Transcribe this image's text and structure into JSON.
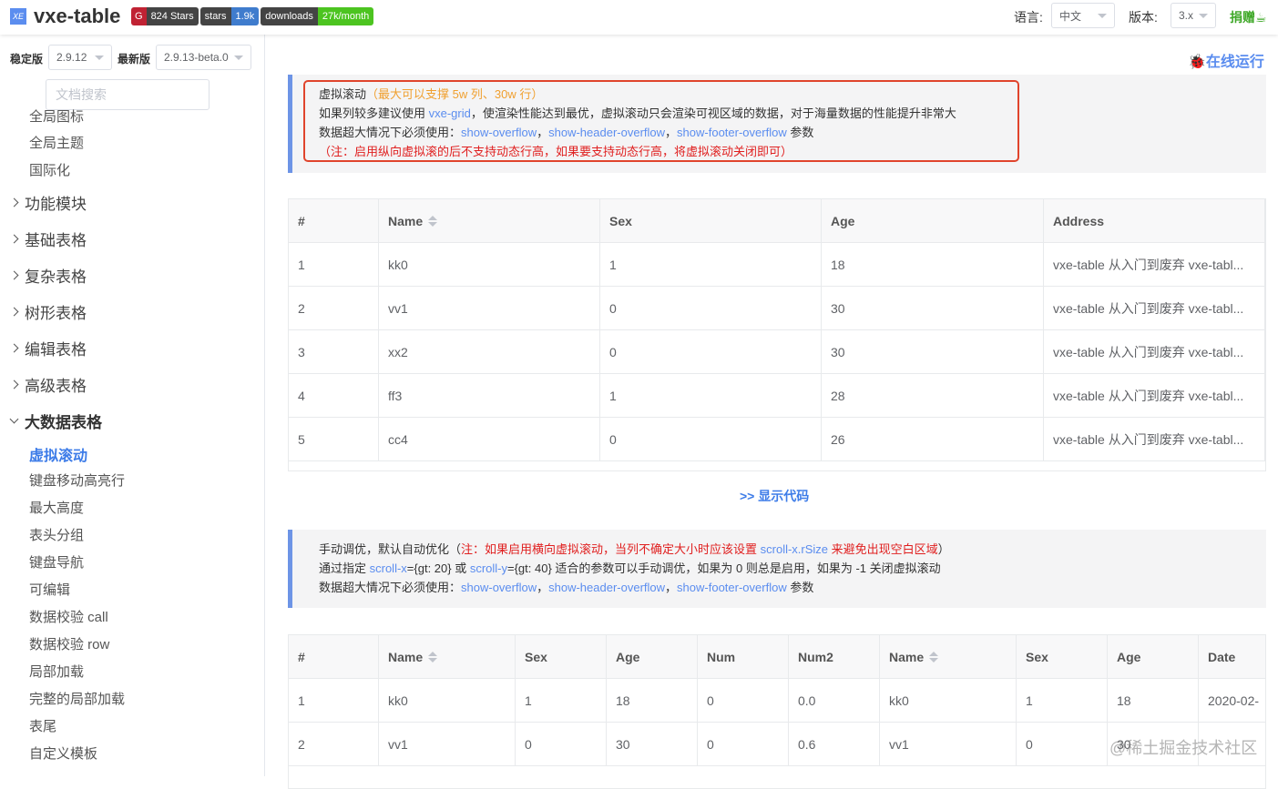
{
  "header": {
    "logo_text": "XE",
    "brand": "vxe-table",
    "badges": [
      {
        "left": "824 Stars"
      },
      {
        "left": "stars",
        "right": "1.9k"
      },
      {
        "left": "downloads",
        "right": "27k/month"
      }
    ],
    "lang_label": "语言:",
    "lang_value": "中文",
    "version_label": "版本:",
    "version_value": "3.x",
    "donate": "捐赠"
  },
  "sidebar": {
    "stable_label": "稳定版",
    "stable_value": "2.9.12",
    "latest_label": "最新版",
    "latest_value": "2.9.13-beta.0",
    "search_placeholder": "文档搜索",
    "top_items": [
      "全局图标",
      "全局主题",
      "国际化"
    ],
    "groups": [
      "功能模块",
      "基础表格",
      "复杂表格",
      "树形表格",
      "编辑表格",
      "高级表格",
      "大数据表格"
    ],
    "sub_items": [
      "虚拟滚动",
      "键盘移动高亮行",
      "最大高度",
      "表头分组",
      "键盘导航",
      "可编辑",
      "数据校验 call",
      "数据校验 row",
      "局部加载",
      "完整的局部加载",
      "表尾",
      "自定义模板"
    ],
    "active": "虚拟滚动"
  },
  "main": {
    "run_online": "在线运行",
    "tip1": {
      "title": "虚拟滚动",
      "title_note": "（最大可以支撑 5w 列、30w 行）",
      "l2a": "如果列较多建议使用 ",
      "l2link": "vxe-grid",
      "l2b": "，使渲染性能达到最优，虚拟滚动只会渲染可视区域的数据，对于海量数据的性能提升非常大",
      "l3a": "数据超大情况下必须使用：",
      "o1": "show-overflow",
      "sep": "，",
      "o2": "show-header-overflow",
      "o3": "show-footer-overflow",
      "l3b": " 参数",
      "l4": "（注：启用纵向虚拟滚的后不支持动态行高，如果要支持动态行高，将虚拟滚动关闭即可）"
    },
    "table1": {
      "headers": [
        "#",
        "Name",
        "Sex",
        "Age",
        "Address"
      ],
      "rows": [
        [
          "1",
          "kk0",
          "1",
          "18",
          "vxe-table 从入门到废弃 vxe-tabl..."
        ],
        [
          "2",
          "vv1",
          "0",
          "30",
          "vxe-table 从入门到废弃 vxe-tabl..."
        ],
        [
          "3",
          "xx2",
          "0",
          "30",
          "vxe-table 从入门到废弃 vxe-tabl..."
        ],
        [
          "4",
          "ff3",
          "1",
          "28",
          "vxe-table 从入门到废弃 vxe-tabl..."
        ],
        [
          "5",
          "cc4",
          "0",
          "26",
          "vxe-table 从入门到废弃 vxe-tabl..."
        ]
      ]
    },
    "show_code": ">> 显示代码",
    "tip2": {
      "l1a": "手动调优，默认自动优化（",
      "l1red": "注：如果启用横向虚拟滚动，当列不确定大小时应该设置 ",
      "l1link": "scroll-x.rSize",
      "l1red2": " 来避免出现空白区域",
      "l1b": "）",
      "l2a": "通过指定 ",
      "sx": "scroll-x",
      "l2b": "={gt: 20} 或 ",
      "sy": "scroll-y",
      "l2c": "={gt: 40} 适合的参数可以手动调优，如果为 0 则总是启用，如果为 -1 关闭虚拟滚动",
      "l3a": "数据超大情况下必须使用：",
      "o1": "show-overflow",
      "sep": "，",
      "o2": "show-header-overflow",
      "o3": "show-footer-overflow",
      "l3b": " 参数"
    },
    "table2": {
      "headers": [
        "#",
        "Name",
        "Sex",
        "Age",
        "Num",
        "Num2",
        "Name",
        "Sex",
        "Age",
        "Date"
      ],
      "rows": [
        [
          "1",
          "kk0",
          "1",
          "18",
          "0",
          "0.0",
          "kk0",
          "1",
          "18",
          "2020-02-"
        ],
        [
          "2",
          "vv1",
          "0",
          "30",
          "0",
          "0.6",
          "vv1",
          "0",
          "30",
          ""
        ]
      ]
    },
    "watermark": "@稀土掘金技术社区"
  }
}
